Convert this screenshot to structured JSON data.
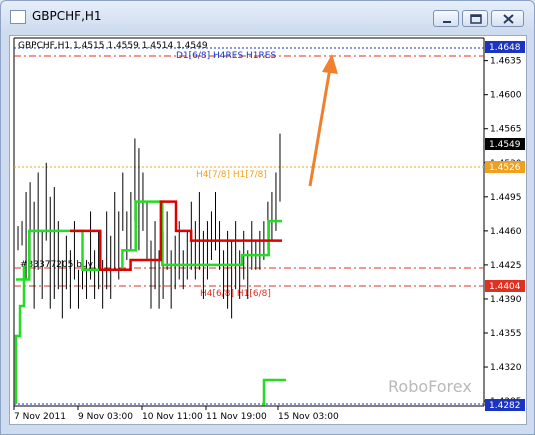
{
  "window": {
    "title": "GBPCHF,H1"
  },
  "chart": {
    "ticker_line": "GBPCHF,H1  1.4515 1.4559 1.4514 1.4549",
    "level_labels": {
      "d1": "D1[6/8] H4RES H1RES",
      "h4_upper": "H4[7/8] H1[7/8]",
      "h4_lower": "H4[6/8] H1[6/8]",
      "order": "#33377205 buy"
    },
    "watermark": "RoboForex",
    "price_boxes": {
      "top": "1.4648",
      "current": "1.4549",
      "orange": "1.4526",
      "red": "1.4404",
      "bottom": "1.4282"
    },
    "colors": {
      "d1_line": "#e03020",
      "orange_line": "#f0a020",
      "red_line": "#e03020",
      "blue_line": "#1a33c0",
      "bid_line": "#000080",
      "green_indicator": "#22dd22",
      "red_indicator": "#e00000",
      "arrow": "#f08030"
    }
  },
  "chart_data": {
    "type": "bar",
    "symbol": "GBPCHF",
    "timeframe": "H1",
    "ohlc_current": {
      "open": 1.4515,
      "high": 1.4559,
      "low": 1.4514,
      "close": 1.4549
    },
    "y_ticks": [
      "1.4635",
      "1.4600",
      "1.4565",
      "1.4530",
      "1.4495",
      "1.4460",
      "1.4425",
      "1.4390",
      "1.4355",
      "1.4320",
      "1.4285"
    ],
    "x_ticks": [
      "7 Nov 2011",
      "9 Nov 03:00",
      "10 Nov 11:00",
      "11 Nov 19:00",
      "15 Nov 03:00"
    ],
    "ylim": [
      1.4282,
      1.4648
    ],
    "levels": [
      {
        "label": "D1[6/8] H4RES H1RES",
        "value": 1.464
      },
      {
        "label": "H4[7/8] H1[7/8]",
        "value": 1.4526
      },
      {
        "label": "H4[6/8] H1[6/8]",
        "value": 1.4404
      },
      {
        "label": "#33377205 buy",
        "value": 1.4425
      }
    ],
    "bars": [
      [
        1.4465,
        1.444
      ],
      [
        1.447,
        1.4445
      ],
      [
        1.45,
        1.441
      ],
      [
        1.451,
        1.443
      ],
      [
        1.449,
        1.438
      ],
      [
        1.452,
        1.442
      ],
      [
        1.446,
        1.439
      ],
      [
        1.453,
        1.445
      ],
      [
        1.4495,
        1.438
      ],
      [
        1.4505,
        1.439
      ],
      [
        1.447,
        1.44
      ],
      [
        1.443,
        1.437
      ],
      [
        1.4455,
        1.44
      ],
      [
        1.444,
        1.438
      ],
      [
        1.447,
        1.441
      ],
      [
        1.442,
        1.438
      ],
      [
        1.445,
        1.44
      ],
      [
        1.443,
        1.439
      ],
      [
        1.448,
        1.441
      ],
      [
        1.444,
        1.439
      ],
      [
        1.446,
        1.44
      ],
      [
        1.443,
        1.438
      ],
      [
        1.448,
        1.44
      ],
      [
        1.4455,
        1.439
      ],
      [
        1.45,
        1.442
      ],
      [
        1.448,
        1.441
      ],
      [
        1.452,
        1.446
      ],
      [
        1.448,
        1.443
      ],
      [
        1.45,
        1.444
      ],
      [
        1.4555,
        1.447
      ],
      [
        1.4545,
        1.444
      ],
      [
        1.452,
        1.446
      ],
      [
        1.449,
        1.443
      ],
      [
        1.445,
        1.438
      ],
      [
        1.447,
        1.44
      ],
      [
        1.444,
        1.438
      ],
      [
        1.446,
        1.439
      ],
      [
        1.448,
        1.442
      ],
      [
        1.444,
        1.438
      ],
      [
        1.4455,
        1.44
      ],
      [
        1.447,
        1.441
      ],
      [
        1.444,
        1.44
      ],
      [
        1.446,
        1.441
      ],
      [
        1.449,
        1.442
      ],
      [
        1.447,
        1.441
      ],
      [
        1.45,
        1.442
      ],
      [
        1.446,
        1.439
      ],
      [
        1.447,
        1.441
      ],
      [
        1.448,
        1.443
      ],
      [
        1.45,
        1.444
      ],
      [
        1.447,
        1.442
      ],
      [
        1.444,
        1.439
      ],
      [
        1.446,
        1.438
      ],
      [
        1.445,
        1.437
      ],
      [
        1.447,
        1.44
      ],
      [
        1.444,
        1.439
      ],
      [
        1.446,
        1.441
      ],
      [
        1.444,
        1.439
      ],
      [
        1.447,
        1.442
      ],
      [
        1.445,
        1.442
      ],
      [
        1.446,
        1.442
      ],
      [
        1.447,
        1.443
      ],
      [
        1.449,
        1.444
      ],
      [
        1.45,
        1.445
      ],
      [
        1.452,
        1.446
      ],
      [
        1.456,
        1.449
      ]
    ],
    "indicators": {
      "green_line": [
        1.441,
        1.446,
        1.446,
        1.446,
        1.446,
        1.442,
        1.442,
        1.442,
        1.444,
        1.449,
        1.449,
        1.4425,
        1.4425,
        1.4425,
        1.4425,
        1.4425,
        1.4425,
        1.4435,
        1.4435,
        1.447
      ],
      "red_line": [
        1.446,
        1.446,
        1.442,
        1.442,
        1.443,
        1.443,
        1.449,
        1.446,
        1.445,
        1.445,
        1.445,
        1.445,
        1.445,
        1.445
      ]
    }
  }
}
